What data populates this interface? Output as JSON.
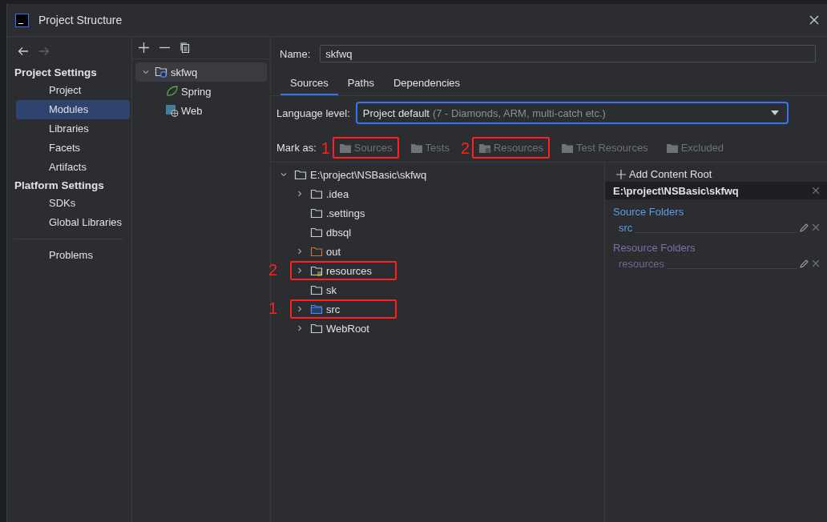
{
  "window": {
    "title": "Project Structure"
  },
  "sidebar": {
    "groups": [
      {
        "title": "Project Settings",
        "items": [
          {
            "label": "Project",
            "selected": false
          },
          {
            "label": "Modules",
            "selected": true
          },
          {
            "label": "Libraries",
            "selected": false
          },
          {
            "label": "Facets",
            "selected": false
          },
          {
            "label": "Artifacts",
            "selected": false
          }
        ]
      },
      {
        "title": "Platform Settings",
        "items": [
          {
            "label": "SDKs",
            "selected": false
          },
          {
            "label": "Global Libraries",
            "selected": false
          }
        ]
      }
    ],
    "footer_items": [
      {
        "label": "Problems",
        "selected": false
      }
    ]
  },
  "modules": {
    "items": [
      {
        "label": "skfwq",
        "kind": "module",
        "selected": true,
        "expanded": true,
        "children": [
          {
            "label": "Spring",
            "kind": "spring",
            "selected": false
          },
          {
            "label": "Web",
            "kind": "web",
            "selected": false
          }
        ]
      }
    ]
  },
  "name_field": {
    "label": "Name:",
    "value": "skfwq"
  },
  "tabs": [
    {
      "label": "Sources",
      "selected": true
    },
    {
      "label": "Paths",
      "selected": false
    },
    {
      "label": "Dependencies",
      "selected": false
    }
  ],
  "language_level": {
    "label": "Language level:",
    "value": "Project default",
    "hint": "(7 - Diamonds, ARM, multi-catch etc.)"
  },
  "mark_as": {
    "label": "Mark as:",
    "buttons": [
      {
        "label": "Sources",
        "kind": "source",
        "annotation": "1"
      },
      {
        "label": "Tests",
        "kind": "test"
      },
      {
        "label": "Resources",
        "kind": "resource",
        "annotation": "2"
      },
      {
        "label": "Test Resources",
        "kind": "test-resource"
      },
      {
        "label": "Excluded",
        "kind": "excluded"
      }
    ]
  },
  "tree": {
    "root": {
      "label": "E:\\project\\NSBasic\\skfwq",
      "expanded": true,
      "children": [
        {
          "label": ".idea",
          "kind": "folder",
          "expandable": true
        },
        {
          "label": ".settings",
          "kind": "folder",
          "expandable": false
        },
        {
          "label": "dbsql",
          "kind": "folder",
          "expandable": false
        },
        {
          "label": "out",
          "kind": "excluded",
          "expandable": true
        },
        {
          "label": "resources",
          "kind": "resource",
          "expandable": true,
          "annotation": "2"
        },
        {
          "label": "sk",
          "kind": "folder",
          "expandable": false
        },
        {
          "label": "src",
          "kind": "source",
          "expandable": true,
          "annotation": "1"
        },
        {
          "label": "WebRoot",
          "kind": "folder",
          "expandable": true
        }
      ]
    }
  },
  "content_roots": {
    "add_label": "Add Content Root",
    "root": "E:\\project\\NSBasic\\skfwq",
    "sections": [
      {
        "title": "Source Folders",
        "kind": "source",
        "folders": [
          "src"
        ]
      },
      {
        "title": "Resource Folders",
        "kind": "resource",
        "folders": [
          "resources"
        ]
      }
    ]
  }
}
